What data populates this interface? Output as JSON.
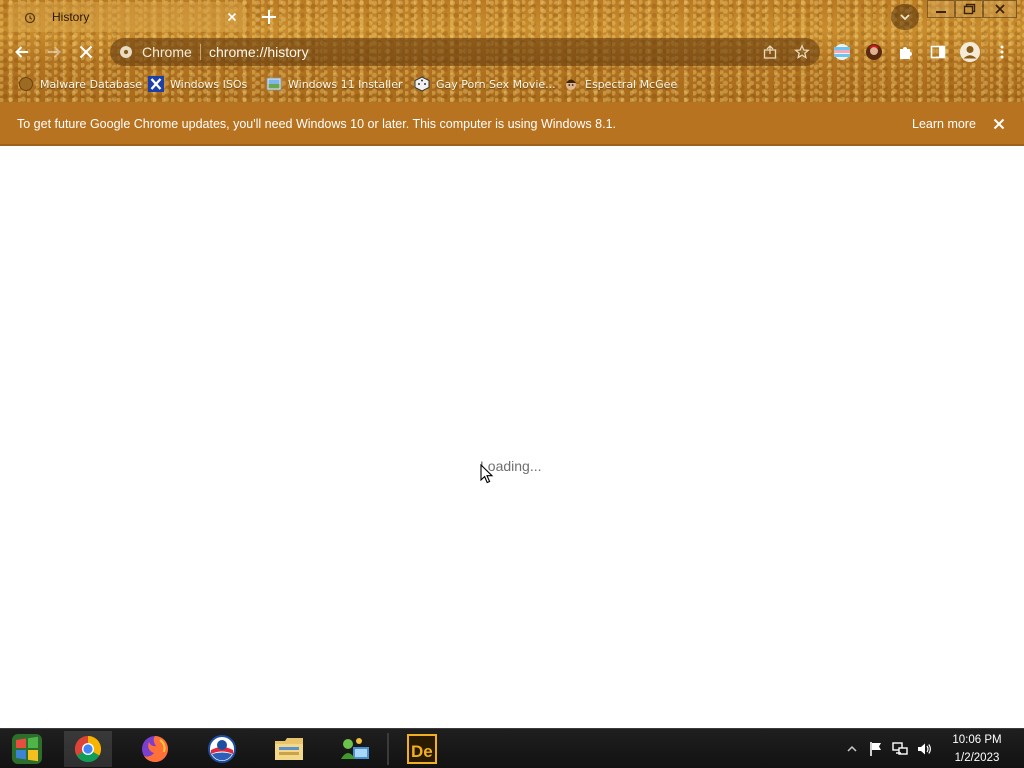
{
  "tab": {
    "title": "History"
  },
  "omnibox": {
    "site_label": "Chrome",
    "url": "chrome://history"
  },
  "bookmarks": [
    {
      "label": "Malware Database",
      "icon": "globe-icon"
    },
    {
      "label": "Windows ISOs",
      "icon": "x-logo-icon"
    },
    {
      "label": "Windows 11 Installer",
      "icon": "image-thumbnail-icon"
    },
    {
      "label": "Gay Porn Sex Movie...",
      "icon": "dice-icon"
    },
    {
      "label": "Espectral McGee",
      "icon": "character-icon"
    }
  ],
  "infobar": {
    "message": "To get future Google Chrome updates, you'll need Windows 10 or later. This computer is using Windows 8.1.",
    "link": "Learn more"
  },
  "content": {
    "loading_text": "Loading..."
  },
  "taskbar": {
    "apps": [
      "start-button",
      "chrome",
      "firefox",
      "opera",
      "file-explorer",
      "network-users",
      "dreameaver"
    ],
    "clock_time": "10:06 PM",
    "clock_date": "1/2/2023"
  },
  "colors": {
    "frame": "#b97a24",
    "infobar": "#b87321",
    "taskbar": "#151515"
  }
}
